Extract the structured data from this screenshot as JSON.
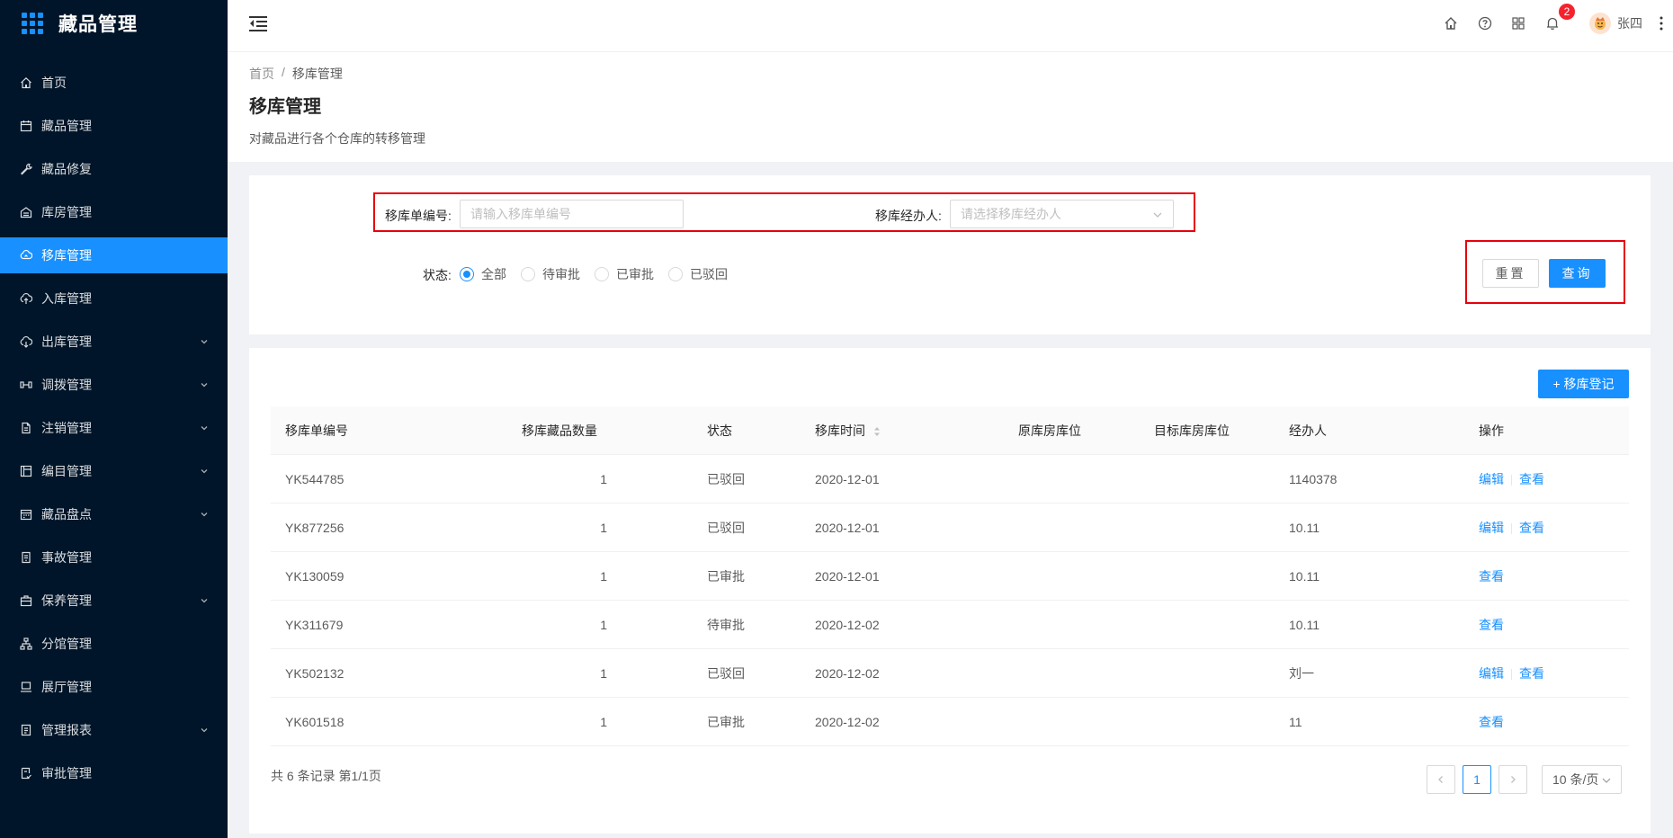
{
  "app": {
    "title": "藏品管理"
  },
  "sidebar": {
    "items": [
      {
        "label": "首页",
        "icon": "home-icon",
        "active": false,
        "expandable": false
      },
      {
        "label": "藏品管理",
        "icon": "calendar-icon",
        "active": false,
        "expandable": false
      },
      {
        "label": "藏品修复",
        "icon": "wrench-icon",
        "active": false,
        "expandable": false
      },
      {
        "label": "库房管理",
        "icon": "warehouse-icon",
        "active": false,
        "expandable": false
      },
      {
        "label": "移库管理",
        "icon": "cloud-sync-icon",
        "active": true,
        "expandable": false
      },
      {
        "label": "入库管理",
        "icon": "cloud-upload-icon",
        "active": false,
        "expandable": false
      },
      {
        "label": "出库管理",
        "icon": "cloud-download-icon",
        "active": false,
        "expandable": true
      },
      {
        "label": "调拨管理",
        "icon": "transfer-icon",
        "active": false,
        "expandable": true
      },
      {
        "label": "注销管理",
        "icon": "file-icon",
        "active": false,
        "expandable": true
      },
      {
        "label": "编目管理",
        "icon": "catalog-icon",
        "active": false,
        "expandable": true
      },
      {
        "label": "藏品盘点",
        "icon": "inventory-icon",
        "active": false,
        "expandable": true
      },
      {
        "label": "事故管理",
        "icon": "accident-icon",
        "active": false,
        "expandable": false
      },
      {
        "label": "保养管理",
        "icon": "maintenance-icon",
        "active": false,
        "expandable": true
      },
      {
        "label": "分馆管理",
        "icon": "branch-icon",
        "active": false,
        "expandable": false
      },
      {
        "label": "展厅管理",
        "icon": "laptop-icon",
        "active": false,
        "expandable": false
      },
      {
        "label": "管理报表",
        "icon": "report-icon",
        "active": false,
        "expandable": true
      },
      {
        "label": "审批管理",
        "icon": "approval-icon",
        "active": false,
        "expandable": false
      }
    ]
  },
  "header": {
    "notification_count": "2",
    "user_name": "张四"
  },
  "breadcrumb": {
    "home": "首页",
    "separator": "/",
    "current": "移库管理"
  },
  "page": {
    "title": "移库管理",
    "description": "对藏品进行各个仓库的转移管理"
  },
  "search": {
    "order_no_label": "移库单编号:",
    "order_no_placeholder": "请输入移库单编号",
    "order_no_value": "",
    "handler_label": "移库经办人:",
    "handler_placeholder": "请选择移库经办人",
    "status_label": "状态:",
    "status_options": [
      "全部",
      "待审批",
      "已审批",
      "已驳回"
    ],
    "status_selected": "全部",
    "reset_label": "重置",
    "query_label": "查询"
  },
  "table": {
    "add_label": "+ 移库登记",
    "columns": [
      "移库单编号",
      "移库藏品数量",
      "状态",
      "移库时间",
      "原库房库位",
      "目标库房库位",
      "经办人",
      "操作"
    ],
    "rows": [
      {
        "id": "YK544785",
        "qty": "1",
        "status": "已驳回",
        "time": "2020-12-01",
        "from": "",
        "to": "",
        "handler": "1140378",
        "actions": [
          "编辑",
          "查看"
        ]
      },
      {
        "id": "YK877256",
        "qty": "1",
        "status": "已驳回",
        "time": "2020-12-01",
        "from": "",
        "to": "",
        "handler": "10.11",
        "actions": [
          "编辑",
          "查看"
        ]
      },
      {
        "id": "YK130059",
        "qty": "1",
        "status": "已审批",
        "time": "2020-12-01",
        "from": "",
        "to": "",
        "handler": "10.11",
        "actions": [
          "查看"
        ]
      },
      {
        "id": "YK311679",
        "qty": "1",
        "status": "待审批",
        "time": "2020-12-02",
        "from": "",
        "to": "",
        "handler": "10.11",
        "actions": [
          "查看"
        ]
      },
      {
        "id": "YK502132",
        "qty": "1",
        "status": "已驳回",
        "time": "2020-12-02",
        "from": "",
        "to": "",
        "handler": "刘一",
        "actions": [
          "编辑",
          "查看"
        ]
      },
      {
        "id": "YK601518",
        "qty": "1",
        "status": "已审批",
        "time": "2020-12-02",
        "from": "",
        "to": "",
        "handler": "11",
        "actions": [
          "查看"
        ]
      }
    ]
  },
  "pagination": {
    "total_text": "共 6 条记录 第1/1页",
    "current_page": "1",
    "page_size": "10 条/页"
  },
  "colors": {
    "sidebar_bg": "#001529",
    "primary": "#1890ff",
    "highlight_box": "#e8000b",
    "badge": "#f5222d"
  }
}
